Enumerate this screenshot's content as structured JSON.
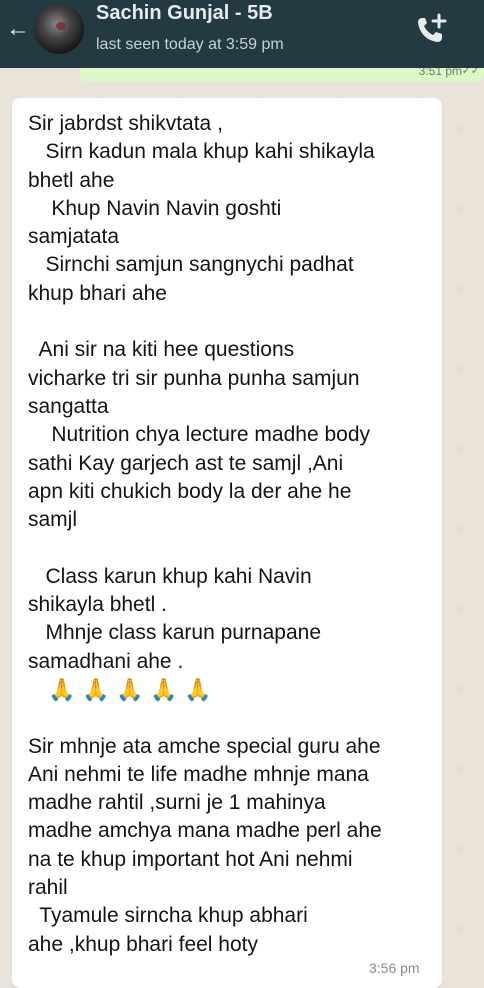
{
  "header": {
    "contact_name": "Sachin Gunjal - 5B",
    "status": "last seen today at 3:59 pm",
    "icons": [
      "back-arrow-icon",
      "avatar",
      "add-call-icon"
    ]
  },
  "previous_message": {
    "time": "3:51 pm",
    "ticks": "✓✓"
  },
  "message": {
    "lines": [
      "Sir jabrdst shikvtata ,",
      "   Sirn kadun mala khup kahi shikayla",
      "bhetl ahe",
      "    Khup Navin Navin goshti",
      "samjatata",
      "   Sirnchi samjun sangnychi padhat",
      "khup bhari ahe",
      "",
      "  Ani sir na kiti hee questions",
      "vicharke tri sir punha punha samjun",
      "sangatta",
      "    Nutrition chya lecture madhe body",
      "sathi Kay garjech ast te samjl ,Ani",
      "apn kiti chukich body la der ahe he",
      "samjl",
      "",
      "   Class karun khup kahi Navin",
      "shikayla bhetl .",
      "   Mhnje class karun purnapane",
      "samadhani ahe .",
      "",
      "",
      "Sir mhnje ata amche special guru ahe",
      "Ani nehmi te life madhe mhnje mana",
      "madhe rahtil ,surni je 1 mahinya",
      "madhe amchya mana madhe perl ahe",
      "na te khup important hot Ani nehmi",
      "rahil",
      "  Tyamule sirncha khup abhari",
      "ahe ,khup bhari feel hoty"
    ],
    "emoji": [
      "🙏",
      "🙏",
      "🙏",
      "🙏",
      "🙏"
    ],
    "time": "3:56 pm"
  },
  "colors": {
    "appbar": "#233a42",
    "background": "#e9e3da",
    "incoming_bubble": "#ffffff",
    "outgoing_bubble": "#dcf8c6"
  }
}
